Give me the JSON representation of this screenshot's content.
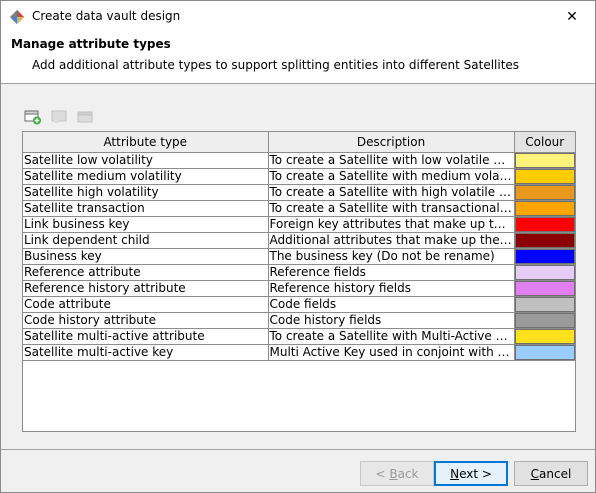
{
  "window": {
    "title": "Create data vault design",
    "close_glyph": "✕"
  },
  "header": {
    "title": "Manage attribute types",
    "description": "Add additional attribute types to support splitting entities into different Satellites"
  },
  "toolbar": {
    "icons": [
      "add-row-icon",
      "edit-row-icon",
      "delete-row-icon"
    ]
  },
  "table": {
    "columns": [
      "Attribute type",
      "Description",
      "Colour"
    ],
    "rows": [
      {
        "type": "Satellite low volatility",
        "description": "To create a Satellite with low volatile attribu...",
        "colour": "#fff27a"
      },
      {
        "type": "Satellite medium volatility",
        "description": "To create a Satellite with medium volatile a...",
        "colour": "#ffcc00"
      },
      {
        "type": "Satellite high volatility",
        "description": "To create a Satellite with high volatile attrib...",
        "colour": "#e8981b"
      },
      {
        "type": "Satellite transaction",
        "description": "To create a Satellite with transactional attri...",
        "colour": "#ffa500"
      },
      {
        "type": "Link business key",
        "description": "Foreign key attributes that make up the Lin...",
        "colour": "#ff0000"
      },
      {
        "type": "Link dependent child",
        "description": "Additional attributes that make up the Link ...",
        "colour": "#8b0000"
      },
      {
        "type": "Business key",
        "description": "The business key (Do not be rename)",
        "colour": "#0000ff"
      },
      {
        "type": "Reference attribute",
        "description": "Reference fields",
        "colour": "#e5ccf5"
      },
      {
        "type": "Reference history attribute",
        "description": "Reference history fields",
        "colour": "#e07ff0"
      },
      {
        "type": "Code attribute",
        "description": "Code fields",
        "colour": "#c0c0c0"
      },
      {
        "type": "Code history attribute",
        "description": "Code history fields",
        "colour": "#9a9a9a"
      },
      {
        "type": "Satellite multi-active attribute",
        "description": "To create a Satellite with Multi-Active attrib...",
        "colour": "#ffe01a"
      },
      {
        "type": "Satellite multi-active key",
        "description": "Multi Active Key used in conjoint with anoth...",
        "colour": "#99ccff"
      }
    ]
  },
  "buttons": {
    "back": {
      "prefix": "< ",
      "mnemonic": "B",
      "rest": "ack"
    },
    "next": {
      "mnemonic": "N",
      "rest": "ext >"
    },
    "cancel": {
      "mnemonic": "C",
      "rest": "ancel"
    }
  }
}
